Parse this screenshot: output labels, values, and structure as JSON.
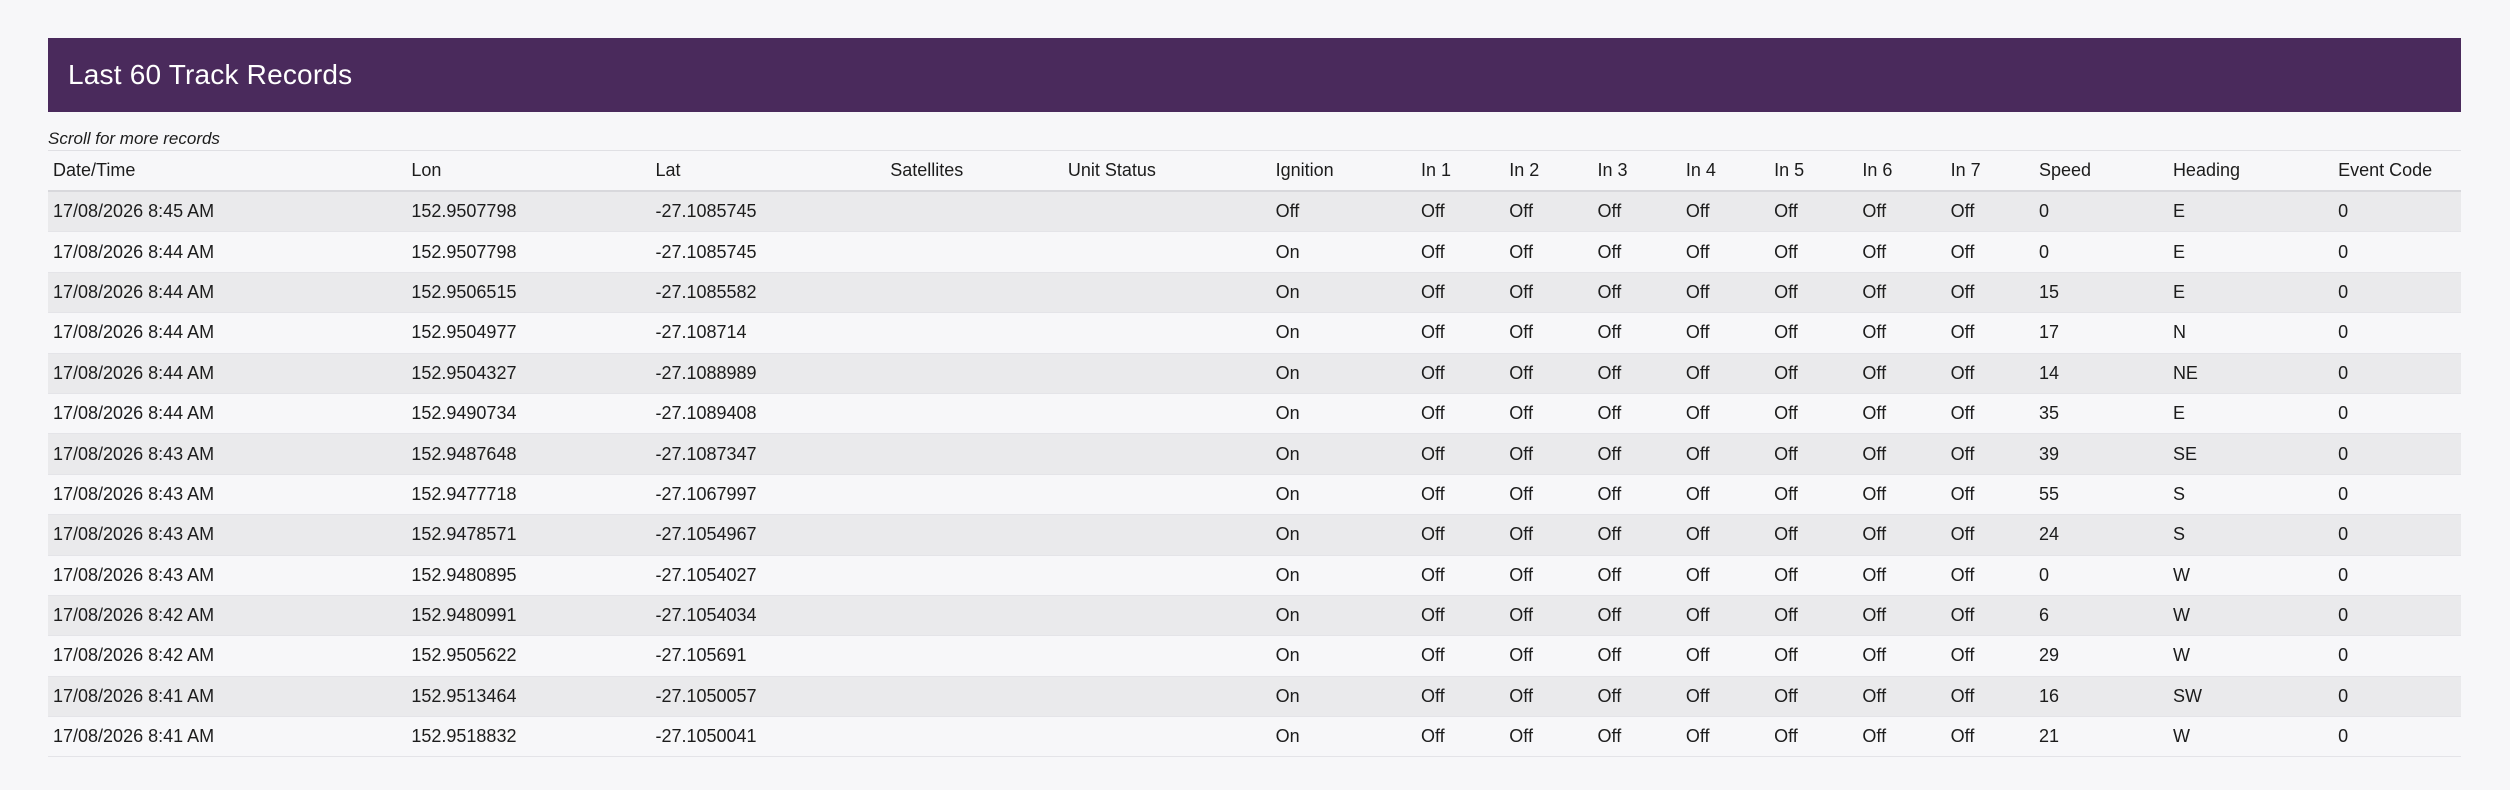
{
  "header": {
    "title": "Last 60 Track Records"
  },
  "scroll_note": "Scroll for more records",
  "table": {
    "columns": [
      "Date/Time",
      "Lon",
      "Lat",
      "Satellites",
      "Unit Status",
      "Ignition",
      "In 1",
      "In 2",
      "In 3",
      "In 4",
      "In 5",
      "In 6",
      "In 7",
      "Speed",
      "Heading",
      "Event Code"
    ],
    "rows": [
      [
        "17/08/2026 8:45 AM",
        "152.9507798",
        "-27.1085745",
        "",
        "",
        "Off",
        "Off",
        "Off",
        "Off",
        "Off",
        "Off",
        "Off",
        "Off",
        "0",
        "E",
        "0"
      ],
      [
        "17/08/2026 8:44 AM",
        "152.9507798",
        "-27.1085745",
        "",
        "",
        "On",
        "Off",
        "Off",
        "Off",
        "Off",
        "Off",
        "Off",
        "Off",
        "0",
        "E",
        "0"
      ],
      [
        "17/08/2026 8:44 AM",
        "152.9506515",
        "-27.1085582",
        "",
        "",
        "On",
        "Off",
        "Off",
        "Off",
        "Off",
        "Off",
        "Off",
        "Off",
        "15",
        "E",
        "0"
      ],
      [
        "17/08/2026 8:44 AM",
        "152.9504977",
        "-27.108714",
        "",
        "",
        "On",
        "Off",
        "Off",
        "Off",
        "Off",
        "Off",
        "Off",
        "Off",
        "17",
        "N",
        "0"
      ],
      [
        "17/08/2026 8:44 AM",
        "152.9504327",
        "-27.1088989",
        "",
        "",
        "On",
        "Off",
        "Off",
        "Off",
        "Off",
        "Off",
        "Off",
        "Off",
        "14",
        "NE",
        "0"
      ],
      [
        "17/08/2026 8:44 AM",
        "152.9490734",
        "-27.1089408",
        "",
        "",
        "On",
        "Off",
        "Off",
        "Off",
        "Off",
        "Off",
        "Off",
        "Off",
        "35",
        "E",
        "0"
      ],
      [
        "17/08/2026 8:43 AM",
        "152.9487648",
        "-27.1087347",
        "",
        "",
        "On",
        "Off",
        "Off",
        "Off",
        "Off",
        "Off",
        "Off",
        "Off",
        "39",
        "SE",
        "0"
      ],
      [
        "17/08/2026 8:43 AM",
        "152.9477718",
        "-27.1067997",
        "",
        "",
        "On",
        "Off",
        "Off",
        "Off",
        "Off",
        "Off",
        "Off",
        "Off",
        "55",
        "S",
        "0"
      ],
      [
        "17/08/2026 8:43 AM",
        "152.9478571",
        "-27.1054967",
        "",
        "",
        "On",
        "Off",
        "Off",
        "Off",
        "Off",
        "Off",
        "Off",
        "Off",
        "24",
        "S",
        "0"
      ],
      [
        "17/08/2026 8:43 AM",
        "152.9480895",
        "-27.1054027",
        "",
        "",
        "On",
        "Off",
        "Off",
        "Off",
        "Off",
        "Off",
        "Off",
        "Off",
        "0",
        "W",
        "0"
      ],
      [
        "17/08/2026 8:42 AM",
        "152.9480991",
        "-27.1054034",
        "",
        "",
        "On",
        "Off",
        "Off",
        "Off",
        "Off",
        "Off",
        "Off",
        "Off",
        "6",
        "W",
        "0"
      ],
      [
        "17/08/2026 8:42 AM",
        "152.9505622",
        "-27.105691",
        "",
        "",
        "On",
        "Off",
        "Off",
        "Off",
        "Off",
        "Off",
        "Off",
        "Off",
        "29",
        "W",
        "0"
      ],
      [
        "17/08/2026 8:41 AM",
        "152.9513464",
        "-27.1050057",
        "",
        "",
        "On",
        "Off",
        "Off",
        "Off",
        "Off",
        "Off",
        "Off",
        "Off",
        "16",
        "SW",
        "0"
      ],
      [
        "17/08/2026 8:41 AM",
        "152.9518832",
        "-27.1050041",
        "",
        "",
        "On",
        "Off",
        "Off",
        "Off",
        "Off",
        "Off",
        "Off",
        "Off",
        "21",
        "W",
        "0"
      ]
    ]
  }
}
